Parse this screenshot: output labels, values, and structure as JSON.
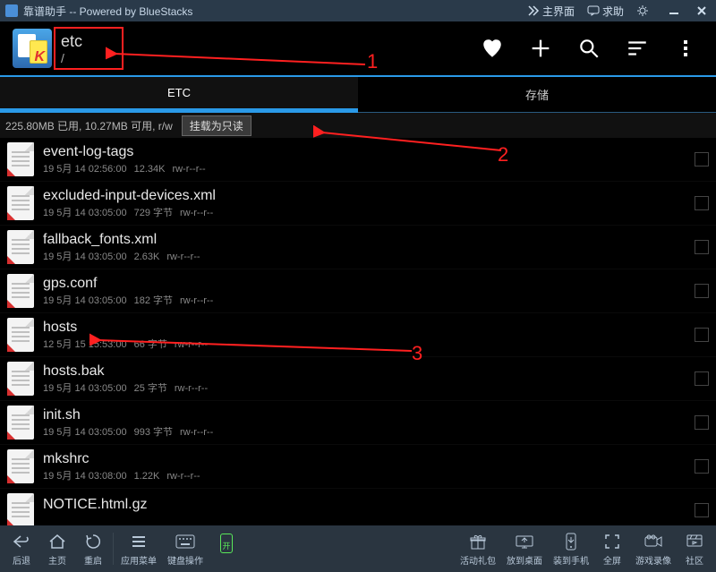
{
  "titlebar": {
    "title": "靠谱助手  -- Powered by BlueStacks",
    "btn_main": "主界面",
    "btn_help": "求助"
  },
  "header": {
    "path_name": "etc",
    "path": "/"
  },
  "tabs": {
    "tab1": "ETC",
    "tab2": "存储"
  },
  "status": {
    "text": "225.80MB 已用, 10.27MB 可用, r/w",
    "mount_btn": "挂载为只读"
  },
  "files": [
    {
      "name": "event-log-tags",
      "date": "19 5月 14 02:56:00",
      "size": "12.34K",
      "perm": "rw-r--r--"
    },
    {
      "name": "excluded-input-devices.xml",
      "date": "19 5月 14 03:05:00",
      "size": "729 字节",
      "perm": "rw-r--r--"
    },
    {
      "name": "fallback_fonts.xml",
      "date": "19 5月 14 03:05:00",
      "size": "2.63K",
      "perm": "rw-r--r--"
    },
    {
      "name": "gps.conf",
      "date": "19 5月 14 03:05:00",
      "size": "182 字节",
      "perm": "rw-r--r--"
    },
    {
      "name": "hosts",
      "date": "12 5月 15 15:53:00",
      "size": "66 字节",
      "perm": "rw-r--r--"
    },
    {
      "name": "hosts.bak",
      "date": "19 5月 14 03:05:00",
      "size": "25 字节",
      "perm": "rw-r--r--"
    },
    {
      "name": "init.sh",
      "date": "19 5月 14 03:05:00",
      "size": "993 字节",
      "perm": "rw-r--r--"
    },
    {
      "name": "mkshrc",
      "date": "19 5月 14 03:08:00",
      "size": "1.22K",
      "perm": "rw-r--r--"
    },
    {
      "name": "NOTICE.html.gz",
      "date": "",
      "size": "",
      "perm": ""
    }
  ],
  "bottombar": {
    "back": "后退",
    "home": "主页",
    "restart": "重启",
    "appmenu": "应用菜单",
    "keyboard": "键盘操作",
    "on": "开",
    "gift": "活动礼包",
    "desktop": "放到桌面",
    "phone": "装到手机",
    "fullscreen": "全屏",
    "record": "游戏录像",
    "community": "社区"
  },
  "annotations": {
    "a1": "1",
    "a2": "2",
    "a3": "3"
  }
}
